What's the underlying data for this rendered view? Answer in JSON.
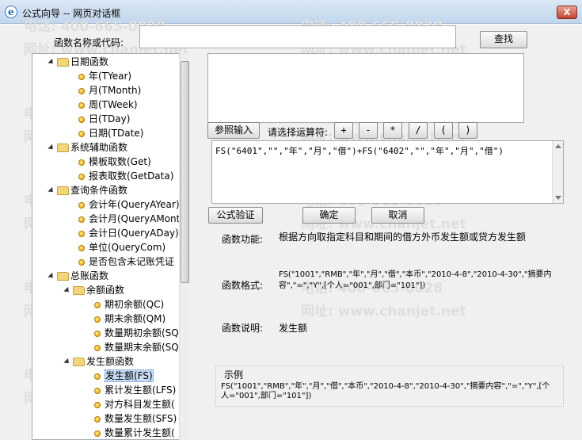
{
  "window": {
    "title": "公式向导 -- 网页对话框",
    "icon": "ie-icon",
    "close_label": "X"
  },
  "watermark": {
    "phone": "电话: 400-665-0028",
    "url": "网址: www.chanjet.net"
  },
  "search": {
    "label": "函数名称或代码:",
    "value": "",
    "button": "查找"
  },
  "tree": [
    {
      "label": "日期函数",
      "kind": "folder",
      "level": 0
    },
    {
      "label": "年(TYear)",
      "kind": "item",
      "level": 1
    },
    {
      "label": "月(TMonth)",
      "kind": "item",
      "level": 1
    },
    {
      "label": "周(TWeek)",
      "kind": "item",
      "level": 1
    },
    {
      "label": "日(TDay)",
      "kind": "item",
      "level": 1
    },
    {
      "label": "日期(TDate)",
      "kind": "item",
      "level": 1
    },
    {
      "label": "系统辅助函数",
      "kind": "folder",
      "level": 0
    },
    {
      "label": "模板取数(Get)",
      "kind": "item",
      "level": 1
    },
    {
      "label": "报表取数(GetData)",
      "kind": "item",
      "level": 1
    },
    {
      "label": "查询条件函数",
      "kind": "folder",
      "level": 0
    },
    {
      "label": "会计年(QueryAYear)",
      "kind": "item",
      "level": 1
    },
    {
      "label": "会计月(QueryAMonth",
      "kind": "item",
      "level": 1
    },
    {
      "label": "会计日(QueryADay)",
      "kind": "item",
      "level": 1
    },
    {
      "label": "单位(QueryCom)",
      "kind": "item",
      "level": 1
    },
    {
      "label": "是否包含未记账凭证",
      "kind": "item",
      "level": 1
    },
    {
      "label": "总账函数",
      "kind": "folder",
      "level": 0
    },
    {
      "label": "余额函数",
      "kind": "folder",
      "level": 1
    },
    {
      "label": "期初余额(QC)",
      "kind": "item",
      "level": 2
    },
    {
      "label": "期末余额(QM)",
      "kind": "item",
      "level": 2
    },
    {
      "label": "数量期初余额(SQ",
      "kind": "item",
      "level": 2
    },
    {
      "label": "数量期末余额(SQ",
      "kind": "item",
      "level": 2
    },
    {
      "label": "发生额函数",
      "kind": "folder",
      "level": 1
    },
    {
      "label": "发生额(FS)",
      "kind": "item",
      "level": 2,
      "selected": true
    },
    {
      "label": "累计发生额(LFS)",
      "kind": "item",
      "level": 2
    },
    {
      "label": "对方科目发生额(",
      "kind": "item",
      "level": 2
    },
    {
      "label": "数量发生额(SFS)",
      "kind": "item",
      "level": 2
    },
    {
      "label": "数量累计发生额(",
      "kind": "item",
      "level": 2
    }
  ],
  "operators": {
    "ref_button": "参照输入",
    "label": "请选择运算符:",
    "ops": [
      "+",
      "-",
      "*",
      "/",
      "(",
      ")"
    ]
  },
  "formula": {
    "text": "FS(\"6401\",\"\",\"年\",\"月\",\"借\")+FS(\"6402\",\"\",\"年\",\"月\",\"借\")"
  },
  "actions": {
    "verify": "公式验证",
    "ok": "确定",
    "cancel": "取消"
  },
  "help": {
    "func_label": "函数功能:",
    "func_text": "根据方向取指定科目和期间的借方外币发生额或贷方发生额",
    "format_label": "函数格式:",
    "format_text": "FS(\"1001\",\"RMB\",\"年\",\"月\",\"借\",\"本币\",\"2010-4-8\",\"2010-4-30\",\"摘要内容\",\"=\",\"Y\",[个人=\"001\",部门=\"101\"])",
    "desc_label": "函数说明:",
    "desc_text": "发生额",
    "example_label": "示例",
    "example_text": "FS(\"1001\",\"RMB\",\"年\",\"月\",\"借\",\"本币\",\"2010-4-8\",\"2010-4-30\",\"摘要内容\",\"=\",\"Y\",[个人=\"001\",部门=\"101\"])"
  }
}
